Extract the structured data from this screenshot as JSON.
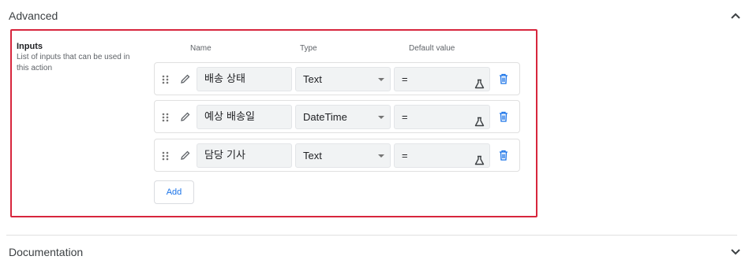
{
  "advanced": {
    "title": "Advanced"
  },
  "inputs": {
    "label": "Inputs",
    "description": "List of inputs that can be used in this action",
    "columns": {
      "name": "Name",
      "type": "Type",
      "default": "Default value"
    },
    "rows": [
      {
        "name": "배송 상태",
        "type": "Text",
        "default": "="
      },
      {
        "name": "예상 배송일",
        "type": "DateTime",
        "default": "="
      },
      {
        "name": "담당 기사",
        "type": "Text",
        "default": "="
      }
    ],
    "add_label": "Add"
  },
  "documentation": {
    "title": "Documentation"
  },
  "colors": {
    "highlight": "#d7263d",
    "accent": "#1a73e8",
    "field_bg": "#f1f3f4"
  },
  "icons": {
    "row_handle": "drag-handle-icon",
    "row_edit": "pencil-icon",
    "default_expr": "flask-icon",
    "row_delete": "trash-icon",
    "advanced_toggle": "chevron-up-icon",
    "docs_toggle": "chevron-down-icon"
  }
}
